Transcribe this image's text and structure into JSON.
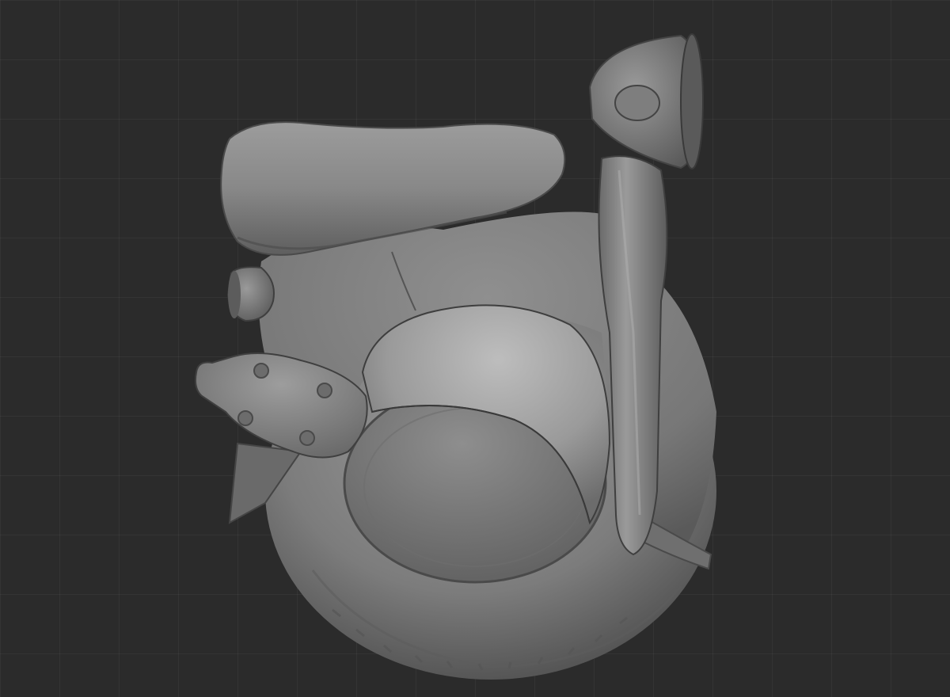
{
  "viewport": {
    "background_color": "#2b2b2b",
    "grid_visible": true,
    "grid_color": "#3a3a3a"
  },
  "model": {
    "name": "",
    "material_color": "#8a8a8a",
    "parts": [
      "wheel-tire",
      "wheel-hub",
      "body-shell",
      "front-fender",
      "seat",
      "headlight",
      "handlebar-stem",
      "tail-light",
      "exhaust-pipe",
      "kickstand"
    ]
  }
}
